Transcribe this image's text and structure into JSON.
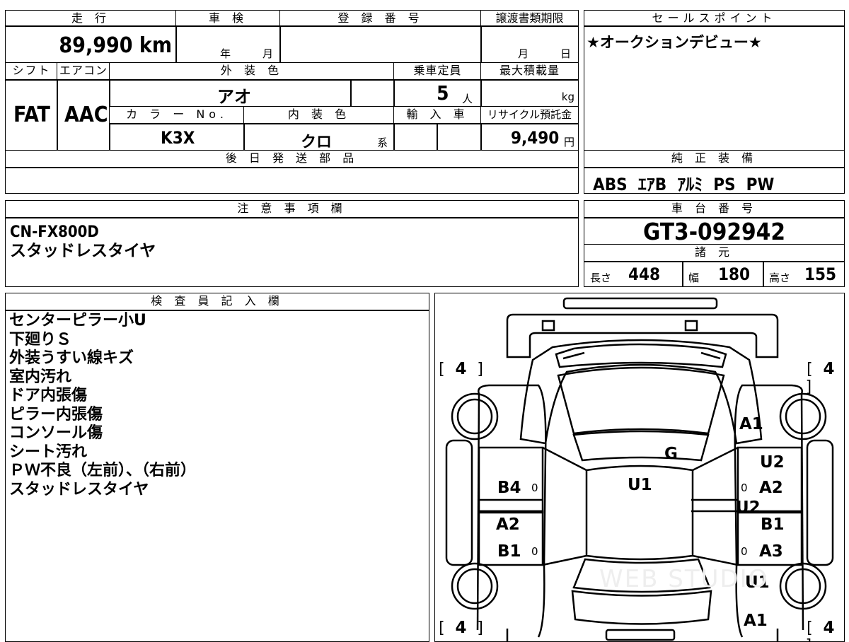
{
  "top_header": {
    "mileage_label": "走 行",
    "inspection_label": "車 検",
    "registration_label": "登 録 番 号",
    "transfer_deadline_label": "譲渡書類期限",
    "sales_point_label": "セールスポイント"
  },
  "mileage": "89,990 km",
  "inspection_year_unit": "年",
  "inspection_month_unit": "月",
  "transfer_month_unit": "月",
  "transfer_day_unit": "日",
  "sales_point": "★オークションデビュー★",
  "row2_header": {
    "shift_label": "シフト",
    "ac_label": "エアコン",
    "exterior_color_label": "外 装 色",
    "capacity_label": "乗車定員",
    "max_load_label": "最大積載量"
  },
  "shift": "FAT",
  "ac": "AAC",
  "exterior_color": "アオ",
  "capacity": "5",
  "capacity_unit": "人",
  "max_load_unit": "kg",
  "row3_header": {
    "color_no_label": "カ ラ ー No.",
    "interior_color_label": "内 装 色",
    "import_label": "輸 入 車",
    "recycle_label": "リサイクル預託金"
  },
  "color_no": "K3X",
  "interior_color": "クロ",
  "interior_suffix": "系",
  "recycle_fee": "9,490",
  "recycle_unit": "円",
  "later_parts_label": "後 日 発 送 部 品",
  "genuine_equipment_label": "純 正 装 備",
  "genuine_equipment": "ABS  ｴｱB  ｱﾙﾐ  PS  PW",
  "notes_label": "注 意 事 項 欄",
  "notes": [
    "CN-FX800D",
    "スタッドレスタイヤ"
  ],
  "chassis_label": "車 台 番 号",
  "chassis_number": "GT3-092942",
  "specs_label": "諸 元",
  "specs": {
    "length_label": "長さ",
    "length": "448",
    "width_label": "幅",
    "width": "180",
    "height_label": "高さ",
    "height": "155"
  },
  "inspector_label": "検 査 員 記 入 欄",
  "inspector_notes": [
    "センターピラー小U",
    "下廻りＳ",
    "外装うすい線キズ",
    "室内汚れ",
    "ドア内張傷",
    "ピラー内張傷",
    "コンソール傷",
    "シート汚れ",
    "ＰＷ不良（左前）、（右前）",
    "スタッドレスタイヤ"
  ],
  "diagram": {
    "tire_tread": [
      "4",
      "4",
      "4",
      "4"
    ],
    "damage_marks": [
      "A1",
      "G",
      "U2",
      "U1",
      "B4",
      "A2",
      "U2",
      "A2",
      "B1",
      "B1",
      "A3",
      "U1",
      "A1"
    ],
    "zero_marks": [
      "0",
      "0",
      "0",
      "0"
    ],
    "watermark": "WEB STUDIO"
  }
}
